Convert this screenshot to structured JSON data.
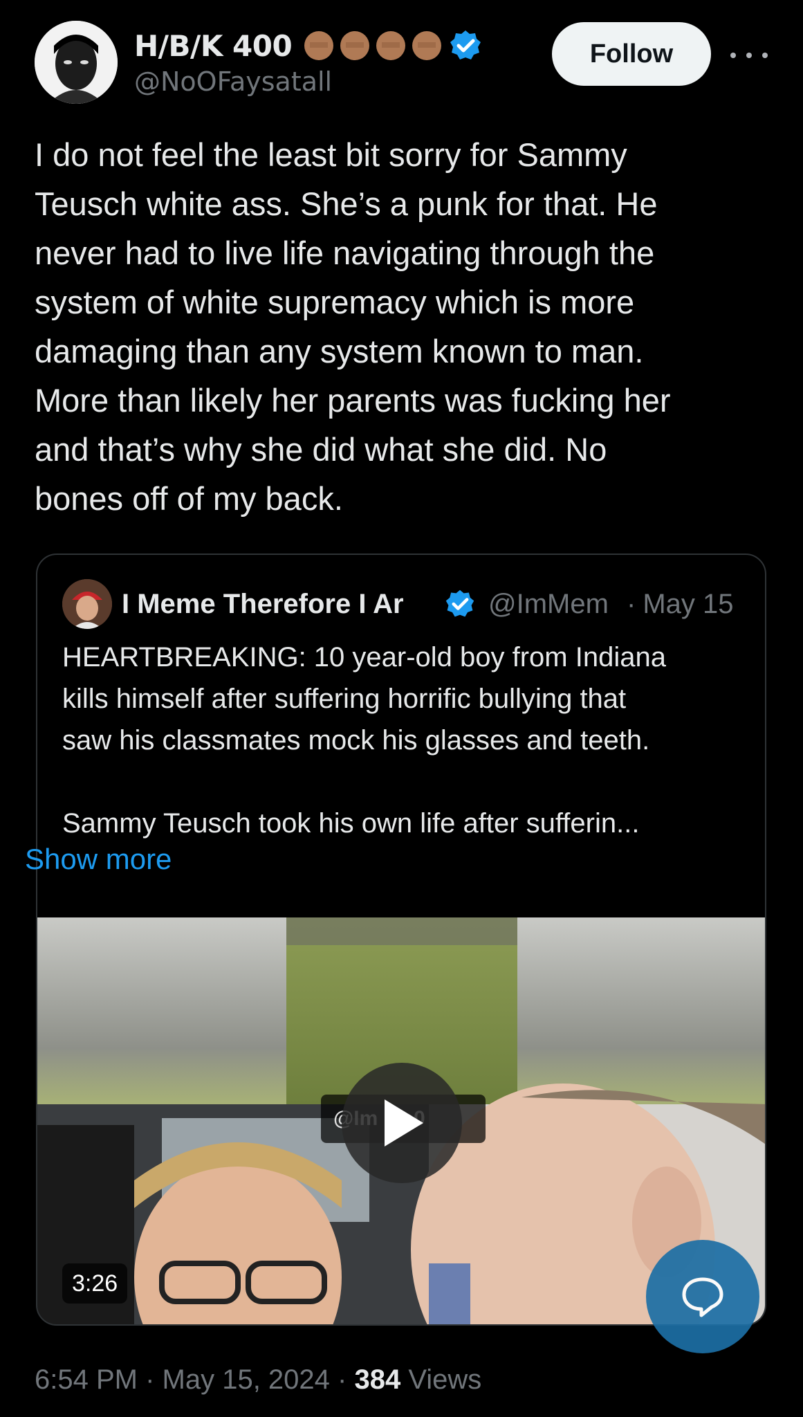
{
  "tweet": {
    "display_name": "H/B/K 400",
    "handle": "@NoOFaysatall",
    "follow_label": "Follow",
    "text": "I do not feel the least bit sorry for  Sammy\nTeusch white ass. She’s a punk for that. He\nnever had to live life navigating through the\nsystem of white supremacy which is more\ndamaging than any system known to man.\nMore than likely her parents was fucking her\nand that’s why she did what she did. No\nbones off of my back.",
    "badge_icons": [
      "raised-fist-emoji",
      "raised-fist-emoji",
      "raised-fist-emoji",
      "raised-fist-emoji",
      "verified-badge-icon"
    ],
    "accent_color": "#1d9bf0"
  },
  "quote": {
    "display_name": "I Meme Therefore I Ar",
    "handle": "@ImMem",
    "separator": "·",
    "date": "May 15",
    "text": "HEARTBREAKING: 10 year-old boy from Indiana\nkills himself after suffering horrific bullying that\nsaw his classmates mock his glasses and teeth.\n\nSammy Teusch took his own life after sufferin...",
    "show_more": "Show more",
    "video": {
      "watermark": "@Im    me0",
      "duration": "3:26"
    }
  },
  "footer": {
    "time": "6:54 PM",
    "sep1": " · ",
    "date": "May 15, 2024",
    "sep2": " · ",
    "views_count": "384",
    "views_label": " Views"
  }
}
